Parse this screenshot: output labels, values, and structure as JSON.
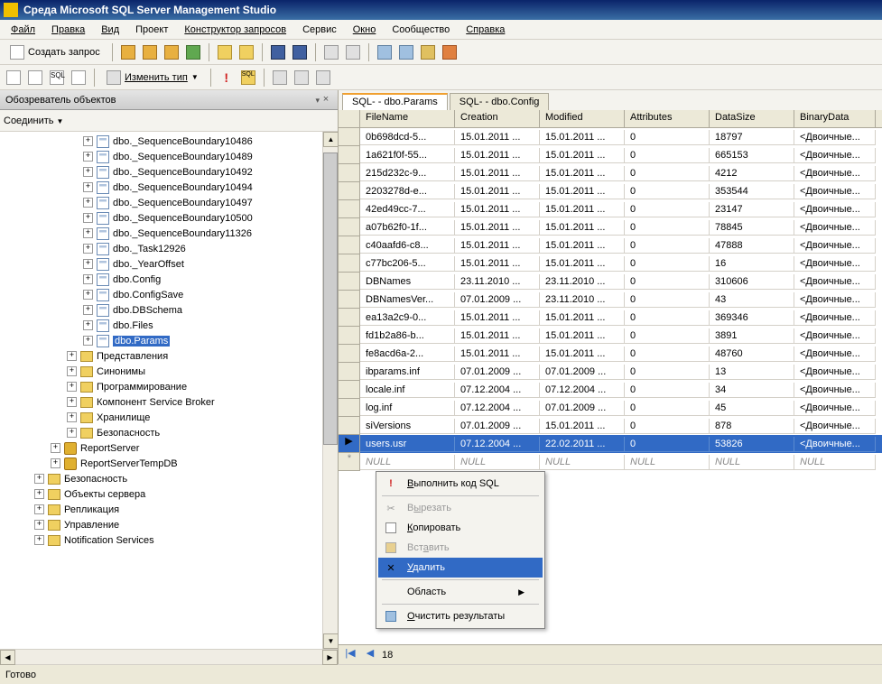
{
  "window": {
    "title": "Среда Microsoft SQL Server Management Studio"
  },
  "menubar": {
    "file": "Файл",
    "edit": "Правка",
    "view": "Вид",
    "project": "Проект",
    "query_designer": "Конструктор запросов",
    "service": "Сервис",
    "window": "Окно",
    "community": "Сообщество",
    "help": "Справка"
  },
  "toolbar1": {
    "create_query": "Создать запрос"
  },
  "toolbar2": {
    "change_type": "Изменить тип"
  },
  "object_explorer": {
    "title": "Обозреватель объектов",
    "connect": "Соединить",
    "tree": [
      {
        "indent": 4,
        "expand": "+",
        "icon": "table",
        "label": "dbo._SequenceBoundary10486"
      },
      {
        "indent": 4,
        "expand": "+",
        "icon": "table",
        "label": "dbo._SequenceBoundary10489"
      },
      {
        "indent": 4,
        "expand": "+",
        "icon": "table",
        "label": "dbo._SequenceBoundary10492"
      },
      {
        "indent": 4,
        "expand": "+",
        "icon": "table",
        "label": "dbo._SequenceBoundary10494"
      },
      {
        "indent": 4,
        "expand": "+",
        "icon": "table",
        "label": "dbo._SequenceBoundary10497"
      },
      {
        "indent": 4,
        "expand": "+",
        "icon": "table",
        "label": "dbo._SequenceBoundary10500"
      },
      {
        "indent": 4,
        "expand": "+",
        "icon": "table",
        "label": "dbo._SequenceBoundary11326"
      },
      {
        "indent": 4,
        "expand": "+",
        "icon": "table",
        "label": "dbo._Task12926"
      },
      {
        "indent": 4,
        "expand": "+",
        "icon": "table",
        "label": "dbo._YearOffset"
      },
      {
        "indent": 4,
        "expand": "+",
        "icon": "table",
        "label": "dbo.Config"
      },
      {
        "indent": 4,
        "expand": "+",
        "icon": "table",
        "label": "dbo.ConfigSave"
      },
      {
        "indent": 4,
        "expand": "+",
        "icon": "table",
        "label": "dbo.DBSchema"
      },
      {
        "indent": 4,
        "expand": "+",
        "icon": "table",
        "label": "dbo.Files"
      },
      {
        "indent": 4,
        "expand": "+",
        "icon": "table",
        "label": "dbo.Params",
        "selected": true
      },
      {
        "indent": 3,
        "expand": "+",
        "icon": "folder",
        "label": "Представления"
      },
      {
        "indent": 3,
        "expand": "+",
        "icon": "folder",
        "label": "Синонимы"
      },
      {
        "indent": 3,
        "expand": "+",
        "icon": "folder",
        "label": "Программирование"
      },
      {
        "indent": 3,
        "expand": "+",
        "icon": "folder",
        "label": "Компонент Service Broker"
      },
      {
        "indent": 3,
        "expand": "+",
        "icon": "folder",
        "label": "Хранилище"
      },
      {
        "indent": 3,
        "expand": "+",
        "icon": "folder",
        "label": "Безопасность"
      },
      {
        "indent": 2,
        "expand": "+",
        "icon": "db",
        "label": "ReportServer"
      },
      {
        "indent": 2,
        "expand": "+",
        "icon": "db",
        "label": "ReportServerTempDB"
      },
      {
        "indent": 1,
        "expand": "+",
        "icon": "folder",
        "label": "Безопасность"
      },
      {
        "indent": 1,
        "expand": "+",
        "icon": "folder",
        "label": "Объекты сервера"
      },
      {
        "indent": 1,
        "expand": "+",
        "icon": "folder",
        "label": "Репликация"
      },
      {
        "indent": 1,
        "expand": "+",
        "icon": "folder",
        "label": "Управление"
      },
      {
        "indent": 1,
        "expand": "+",
        "icon": "folder",
        "label": "Notification Services"
      }
    ]
  },
  "tabs": [
    {
      "label": "SQL-                  - dbo.Params",
      "active": true
    },
    {
      "label": "SQL-                  - dbo.Config",
      "active": false
    }
  ],
  "grid": {
    "columns": [
      "FileName",
      "Creation",
      "Modified",
      "Attributes",
      "DataSize",
      "BinaryData"
    ],
    "rows": [
      [
        "0b698dcd-5...",
        "15.01.2011 ...",
        "15.01.2011 ...",
        "0",
        "18797",
        "<Двоичные..."
      ],
      [
        "1a621f0f-55...",
        "15.01.2011 ...",
        "15.01.2011 ...",
        "0",
        "665153",
        "<Двоичные..."
      ],
      [
        "215d232c-9...",
        "15.01.2011 ...",
        "15.01.2011 ...",
        "0",
        "4212",
        "<Двоичные..."
      ],
      [
        "2203278d-e...",
        "15.01.2011 ...",
        "15.01.2011 ...",
        "0",
        "353544",
        "<Двоичные..."
      ],
      [
        "42ed49cc-7...",
        "15.01.2011 ...",
        "15.01.2011 ...",
        "0",
        "23147",
        "<Двоичные..."
      ],
      [
        "a07b62f0-1f...",
        "15.01.2011 ...",
        "15.01.2011 ...",
        "0",
        "78845",
        "<Двоичные..."
      ],
      [
        "c40aafd6-c8...",
        "15.01.2011 ...",
        "15.01.2011 ...",
        "0",
        "47888",
        "<Двоичные..."
      ],
      [
        "c77bc206-5...",
        "15.01.2011 ...",
        "15.01.2011 ...",
        "0",
        "16",
        "<Двоичные..."
      ],
      [
        "DBNames",
        "23.11.2010 ...",
        "23.11.2010 ...",
        "0",
        "310606",
        "<Двоичные..."
      ],
      [
        "DBNamesVer...",
        "07.01.2009 ...",
        "23.11.2010 ...",
        "0",
        "43",
        "<Двоичные..."
      ],
      [
        "ea13a2c9-0...",
        "15.01.2011 ...",
        "15.01.2011 ...",
        "0",
        "369346",
        "<Двоичные..."
      ],
      [
        "fd1b2a86-b...",
        "15.01.2011 ...",
        "15.01.2011 ...",
        "0",
        "3891",
        "<Двоичные..."
      ],
      [
        "fe8acd6a-2...",
        "15.01.2011 ...",
        "15.01.2011 ...",
        "0",
        "48760",
        "<Двоичные..."
      ],
      [
        "ibparams.inf",
        "07.01.2009 ...",
        "07.01.2009 ...",
        "0",
        "13",
        "<Двоичные..."
      ],
      [
        "locale.inf",
        "07.12.2004 ...",
        "07.12.2004 ...",
        "0",
        "34",
        "<Двоичные..."
      ],
      [
        "log.inf",
        "07.12.2004 ...",
        "07.01.2009 ...",
        "0",
        "45",
        "<Двоичные..."
      ],
      [
        "siVersions",
        "07.01.2009 ...",
        "15.01.2011 ...",
        "0",
        "878",
        "<Двоичные..."
      ]
    ],
    "selected_row": [
      "users.usr",
      "07.12.2004 ...",
      "22.02.2011 ...",
      "0",
      "53826",
      "<Двоичные..."
    ],
    "new_row": [
      "NULL",
      "NULL",
      "NULL",
      "NULL",
      "NULL",
      "NULL"
    ],
    "nav_pos": "18"
  },
  "context_menu": {
    "execute_sql": "Выполнить код SQL",
    "cut": "Вырезать",
    "copy": "Копировать",
    "paste": "Вставить",
    "delete": "Удалить",
    "region": "Область",
    "clear_results": "Очистить результаты"
  },
  "statusbar": {
    "text": "Готово"
  }
}
